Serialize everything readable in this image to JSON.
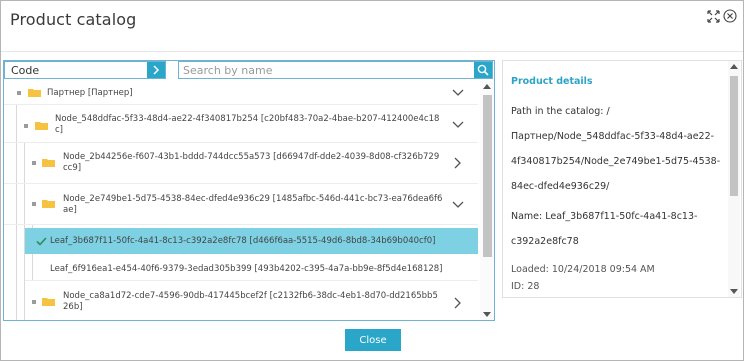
{
  "dialog": {
    "title": "Product catalog"
  },
  "filter": {
    "code_label": "Code",
    "search_placeholder": "Search by name"
  },
  "tree": {
    "items": [
      {
        "label": "Партнер [Партнер]",
        "state": "expanded"
      },
      {
        "label": "Node_548ddfac-5f33-48d4-ae22-4f340817b254 [c20bf483-70a2-4bae-b207-412400e4c18c]",
        "state": "expanded"
      },
      {
        "label": "Node_2b44256e-f607-43b1-bddd-744dcc55a573 [d66947df-dde2-4039-8d08-cf326b729cc9]",
        "state": "collapsed"
      },
      {
        "label": "Node_2e749be1-5d75-4538-84ec-dfed4e936c29 [1485afbc-546d-441c-bc73-ea76dea6f6ae]",
        "state": "expanded"
      },
      {
        "label": "Leaf_3b687f11-50fc-4a41-8c13-c392a2e8fc78 [d466f6aa-5515-49d6-8bd8-34b69b040cf0]",
        "state": "selected"
      },
      {
        "label": "Leaf_6f916ea1-e454-40f6-9379-3edad305b399 [493b4202-c395-4a7a-bb9e-8f5d4e168128]",
        "state": "leaf"
      },
      {
        "label": "Node_ca8a1d72-cde7-4596-90db-417445bcef2f [c2132fb6-38dc-4eb1-8d70-dd2165bb526b]",
        "state": "collapsed"
      }
    ]
  },
  "details": {
    "title": "Product details",
    "path": "Path in the catalog: / Партнер/Node_548ddfac-5f33-48d4-ae22-4f340817b254/Node_2e749be1-5d75-4538-84ec-dfed4e936c29/",
    "name": "Name: Leaf_3b687f11-50fc-4a41-8c13-c392a2e8fc78",
    "loaded": "Loaded: 10/24/2018 09:54 AM",
    "id": "ID: 28"
  },
  "footer": {
    "close_label": "Close"
  },
  "colors": {
    "accent": "#2aa6c9",
    "selected_row": "#7dd1e3",
    "folder": "#f5c242"
  }
}
